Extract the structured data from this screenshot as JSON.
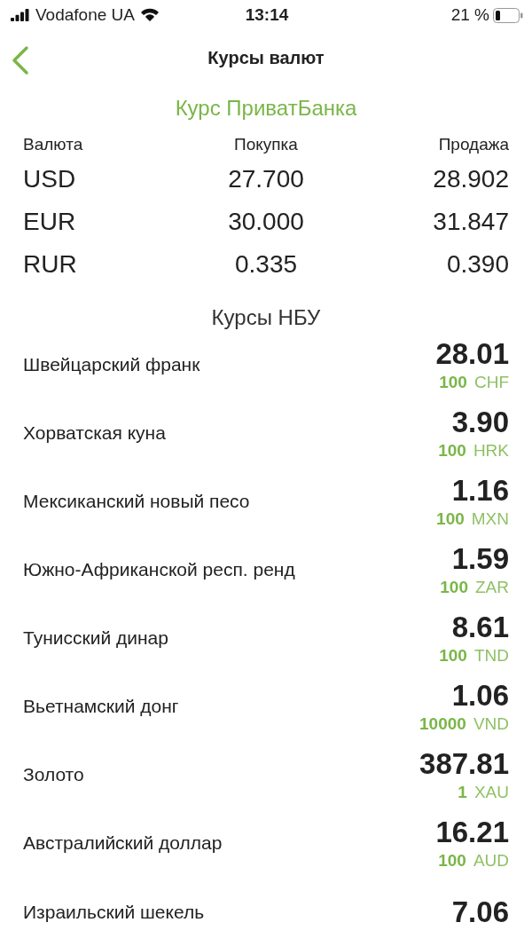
{
  "status_bar": {
    "carrier": "Vodafone UA",
    "time": "13:14",
    "battery": "21 %"
  },
  "nav": {
    "title": "Курсы валют"
  },
  "privatbank": {
    "title": "Курс ПриватБанка",
    "columns": [
      "Валюта",
      "Покупка",
      "Продажа"
    ],
    "rows": [
      {
        "currency": "USD",
        "buy": "27.700",
        "sell": "28.902"
      },
      {
        "currency": "EUR",
        "buy": "30.000",
        "sell": "31.847"
      },
      {
        "currency": "RUR",
        "buy": "0.335",
        "sell": "0.390"
      }
    ]
  },
  "nbu": {
    "title": "Курсы НБУ",
    "rows": [
      {
        "name": "Швейцарский франк",
        "rate": "28.01",
        "amount": "100",
        "code": "CHF"
      },
      {
        "name": "Хорватская куна",
        "rate": "3.90",
        "amount": "100",
        "code": "HRK"
      },
      {
        "name": "Мексиканский новый песо",
        "rate": "1.16",
        "amount": "100",
        "code": "MXN"
      },
      {
        "name": "Южно-Африканской респ. ренд",
        "rate": "1.59",
        "amount": "100",
        "code": "ZAR"
      },
      {
        "name": "Тунисский динар",
        "rate": "8.61",
        "amount": "100",
        "code": "TND"
      },
      {
        "name": "Вьетнамский донг",
        "rate": "1.06",
        "amount": "10000",
        "code": "VND"
      },
      {
        "name": "Золото",
        "rate": "387.81",
        "amount": "1",
        "code": "XAU"
      },
      {
        "name": "Австралийский доллар",
        "rate": "16.21",
        "amount": "100",
        "code": "AUD"
      },
      {
        "name": "Израильский шекель",
        "rate": "7.06"
      }
    ]
  }
}
